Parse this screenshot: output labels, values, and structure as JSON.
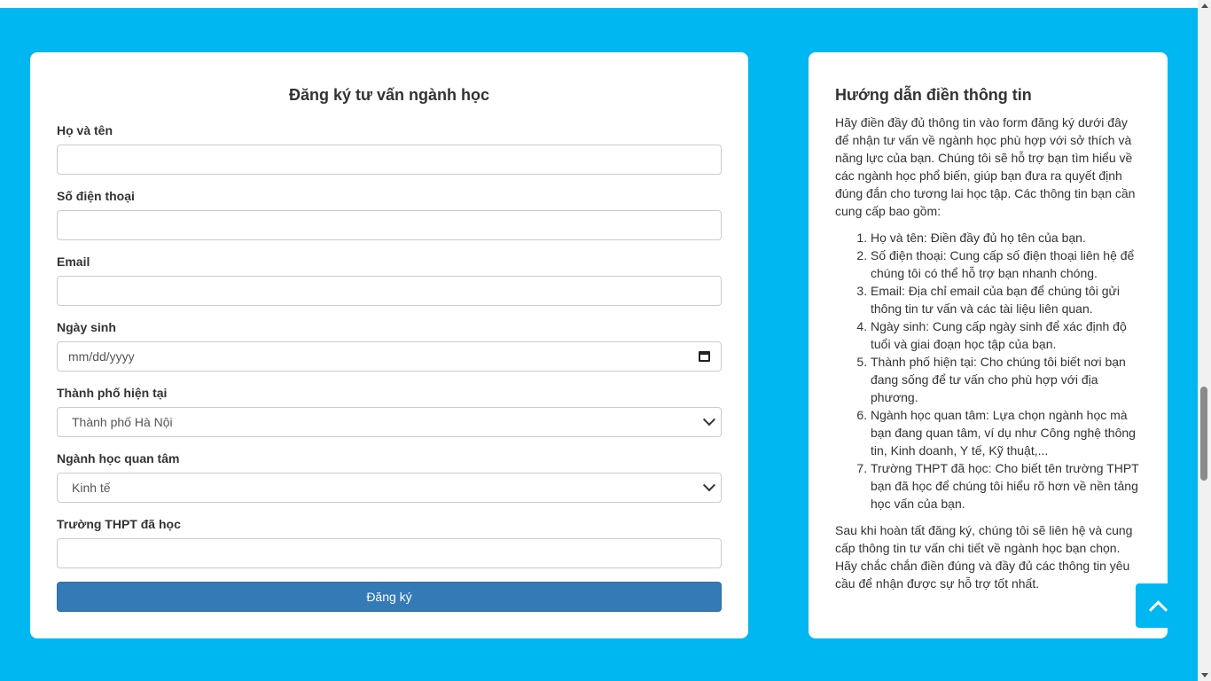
{
  "form": {
    "title": "Đăng ký tư vấn ngành học",
    "fields": {
      "full_name": {
        "label": "Họ và tên",
        "value": ""
      },
      "phone": {
        "label": "Số điện thoại",
        "value": ""
      },
      "email": {
        "label": "Email",
        "value": ""
      },
      "birthdate": {
        "label": "Ngày sinh",
        "placeholder": "mm/dd/yyyy"
      },
      "city": {
        "label": "Thành phố hiện tại",
        "selected": "Thành phố Hà Nội"
      },
      "major": {
        "label": "Ngành học quan tâm",
        "selected": "Kinh tế"
      },
      "school": {
        "label": "Trường THPT đã học",
        "value": ""
      }
    },
    "submit_label": "Đăng ký"
  },
  "guide": {
    "title": "Hướng dẫn điền thông tin",
    "intro": "Hãy điền đầy đủ thông tin vào form đăng ký dưới đây để nhận tư vấn về ngành học phù hợp với sở thích và năng lực của bạn. Chúng tôi sẽ hỗ trợ bạn tìm hiểu về các ngành học phổ biến, giúp bạn đưa ra quyết định đúng đắn cho tương lai học tập. Các thông tin bạn cần cung cấp bao gồm:",
    "items": [
      "Họ và tên: Điền đầy đủ họ tên của bạn.",
      "Số điện thoại: Cung cấp số điện thoại liên hệ để chúng tôi có thể hỗ trợ bạn nhanh chóng.",
      "Email: Địa chỉ email của bạn để chúng tôi gửi thông tin tư vấn và các tài liệu liên quan.",
      "Ngày sinh: Cung cấp ngày sinh để xác định độ tuổi và giai đoạn học tập của bạn.",
      "Thành phố hiện tại: Cho chúng tôi biết nơi bạn đang sống để tư vấn cho phù hợp với địa phương.",
      "Ngành học quan tâm: Lựa chọn ngành học mà bạn đang quan tâm, ví dụ như Công nghệ thông tin, Kinh doanh, Y tế, Kỹ thuật,...",
      "Trường THPT đã học: Cho biết tên trường THPT bạn đã học để chúng tôi hiểu rõ hơn về nền tảng học vấn của bạn."
    ],
    "outro": "Sau khi hoàn tất đăng ký, chúng tôi sẽ liên hệ và cung cấp thông tin tư vấn chi tiết về ngành học bạn chọn. Hãy chắc chắn điền đúng và đầy đủ các thông tin yêu cầu để nhận được sự hỗ trợ tốt nhất."
  },
  "icons": {
    "calendar": "calendar-icon",
    "dropdown": "chevron-down-icon",
    "scroll_top": "chevron-up-icon"
  },
  "colors": {
    "page_background": "#00b7f1",
    "primary_button": "#337ab7",
    "card_background": "#ffffff"
  }
}
